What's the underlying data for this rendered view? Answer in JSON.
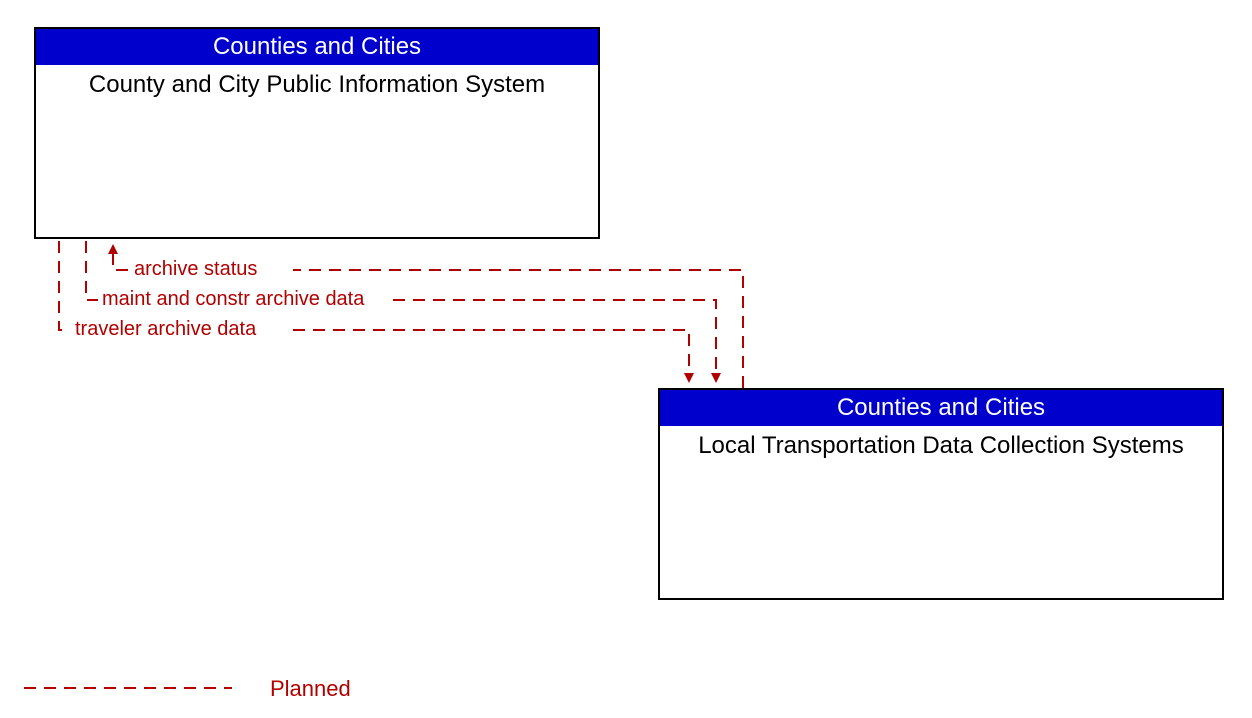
{
  "entities": {
    "top": {
      "header": "Counties and Cities",
      "body": "County and City Public Information System"
    },
    "bottom": {
      "header": "Counties and Cities",
      "body": "Local Transportation Data Collection Systems"
    }
  },
  "flows": {
    "archive_status": "archive status",
    "maint_constr": "maint and constr archive data",
    "traveler": "traveler archive data"
  },
  "legend": {
    "planned": "Planned"
  },
  "colors": {
    "header_bg": "#0000CC",
    "flow_color": "#B00000"
  }
}
